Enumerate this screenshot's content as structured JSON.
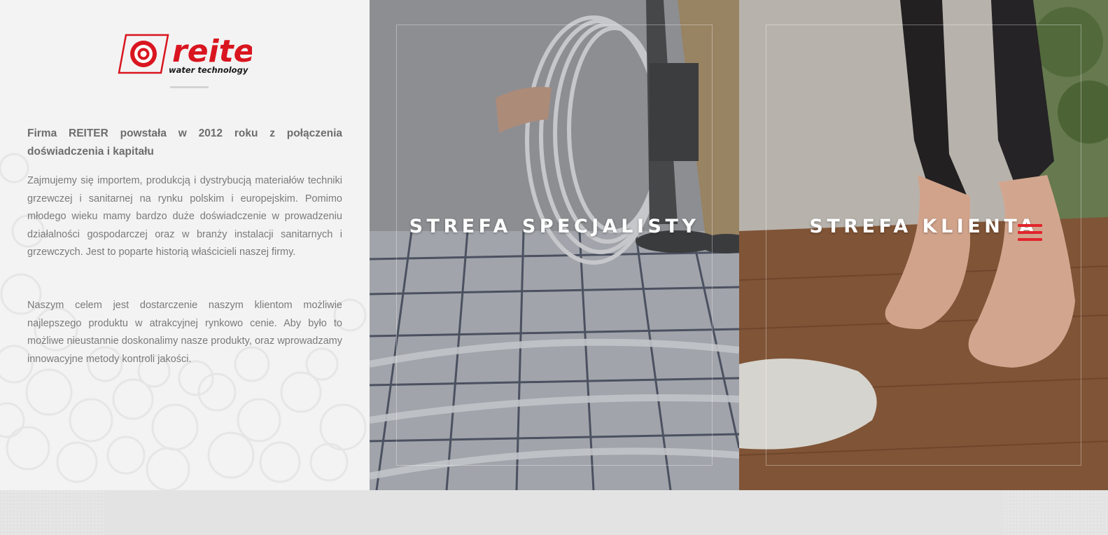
{
  "brand": {
    "name": "reiter",
    "tagline": "water technology",
    "accent_color": "#d9151f"
  },
  "about": {
    "heading": "Firma REITER powstała w 2012 roku z połączenia doświadczenia i kapitału",
    "paragraphs": [
      "Zajmujemy się importem, produkcją i dystrybucją materiałów techniki grzewczej i sanitarnej na rynku polskim i europejskim. Pomimo młodego wieku mamy bardzo duże doświadczenie w prowadzeniu działalności gospodarczej oraz w branży instalacji sanitarnych i grzewczych. Jest to poparte historią właścicieli naszej firmy.",
      "Naszym celem jest dostarczenie naszym klientom możliwie najlepszego produktu w atrakcyjnej rynkowo cenie. Aby było to możliwe nieustannie doskonalimy nasze produkty, oraz wprowadzamy innowacyjne metody kontroli jakości."
    ]
  },
  "zones": {
    "specialist": {
      "title": "STREFA SPECJALISTY",
      "image": "underfloor-heating-pipes-installation"
    },
    "client": {
      "title": "STREFA KLIENTA",
      "image": "bare-feet-on-wooden-floor"
    }
  },
  "menu": {
    "icon": "hamburger-menu-icon",
    "color": "#e2242c"
  }
}
